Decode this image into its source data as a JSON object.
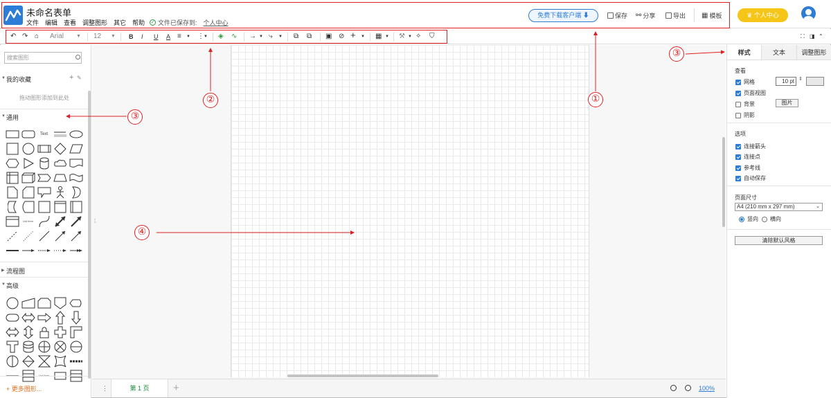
{
  "header": {
    "title": "未命名表单",
    "menu": [
      "文件",
      "编辑",
      "查看",
      "调整图形",
      "其它",
      "帮助"
    ],
    "saved_text": "文件已保存到:",
    "saved_location": "个人中心",
    "download_btn": "免费下载客户端",
    "save": "保存",
    "share": "分享",
    "export": "导出",
    "template": "模板",
    "user_center": "个人中心"
  },
  "toolbar": {
    "font": "Arial",
    "font_size": "12",
    "bold": "B",
    "italic": "I",
    "underline": "U",
    "font_color": "A"
  },
  "left": {
    "search_placeholder": "搜索图形",
    "favorites": "我的收藏",
    "favorites_hint": "拖动图形添加到此处",
    "general": "通用",
    "flowchart": "流程图",
    "advanced": "高级",
    "more_shapes": "+ 更多图形..."
  },
  "bottom": {
    "page_tab": "第 1 页",
    "zoom": "100%"
  },
  "right": {
    "tabs": [
      "样式",
      "文本",
      "调整图形"
    ],
    "view_heading": "查看",
    "grid": "网格",
    "grid_size": "10 pt",
    "page_view": "页面视图",
    "background": "背景",
    "image_btn": "图片",
    "shadow": "阴影",
    "options_heading": "选项",
    "connection_arrows": "连接箭头",
    "connection_points": "连接点",
    "guides": "参考线",
    "autosave": "自动保存",
    "paper_heading": "页面尺寸",
    "paper_size": "A4 (210 mm x 297 mm)",
    "portrait": "竖向",
    "landscape": "横向",
    "reset_style": "清除默认风格"
  },
  "annotations": [
    "①",
    "②",
    "③",
    "③",
    "④"
  ],
  "colors": {
    "accent": "#2d7cd6",
    "annotation": "#e02020",
    "user_center": "#f5c518",
    "page_tab": "#1a8a3a"
  }
}
